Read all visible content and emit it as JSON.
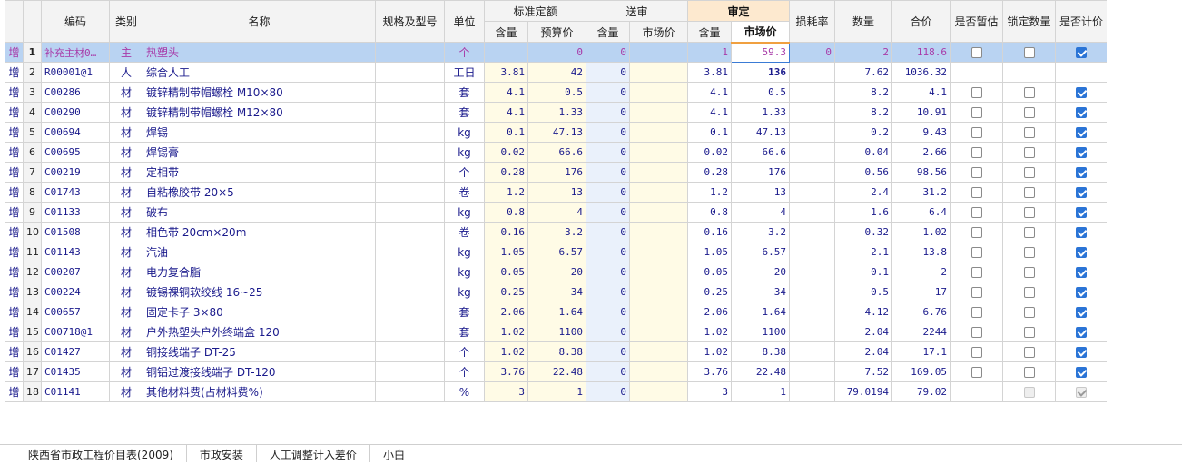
{
  "headers": {
    "code": "编码",
    "category": "类别",
    "name": "名称",
    "spec": "规格及型号",
    "unit": "单位",
    "standard_group": "标准定额",
    "submit_group": "送审",
    "audit_group": "审定",
    "loss_rate": "损耗率",
    "quantity": "数量",
    "total": "合价",
    "is_estimate": "是否暂估",
    "lock_qty": "锁定数量",
    "is_priced": "是否计价",
    "sub_qty": "含量",
    "sub_budget": "预算价",
    "sub_market": "市场价"
  },
  "rows": [
    {
      "ind": "增",
      "idx": "1",
      "code": "补充主材0…",
      "cat": "主",
      "name": "热塑头",
      "spec": "",
      "unit": "个",
      "std_qty": "",
      "std_price": "0",
      "sub_qty": "0",
      "sub_market": "",
      "aud_qty": "1",
      "aud_market": "59.3",
      "loss": "0",
      "qty": "2",
      "total": "118.6",
      "est": "off",
      "lock": "off",
      "priced": "on"
    },
    {
      "ind": "增",
      "idx": "2",
      "code": "R00001@1",
      "cat": "人",
      "name": "综合人工",
      "spec": "",
      "unit": "工日",
      "std_qty": "3.81",
      "std_price": "42",
      "sub_qty": "0",
      "sub_market": "",
      "aud_qty": "3.81",
      "aud_market": "136",
      "loss": "",
      "qty": "7.62",
      "total": "1036.32",
      "est": "",
      "lock": "",
      "priced": ""
    },
    {
      "ind": "增",
      "idx": "3",
      "code": "C00286",
      "cat": "材",
      "name": "镀锌精制带帽螺栓 M10×80",
      "spec": "",
      "unit": "套",
      "std_qty": "4.1",
      "std_price": "0.5",
      "sub_qty": "0",
      "sub_market": "",
      "aud_qty": "4.1",
      "aud_market": "0.5",
      "loss": "",
      "qty": "8.2",
      "total": "4.1",
      "est": "off",
      "lock": "off",
      "priced": "on"
    },
    {
      "ind": "增",
      "idx": "4",
      "code": "C00290",
      "cat": "材",
      "name": "镀锌精制带帽螺栓 M12×80",
      "spec": "",
      "unit": "套",
      "std_qty": "4.1",
      "std_price": "1.33",
      "sub_qty": "0",
      "sub_market": "",
      "aud_qty": "4.1",
      "aud_market": "1.33",
      "loss": "",
      "qty": "8.2",
      "total": "10.91",
      "est": "off",
      "lock": "off",
      "priced": "on"
    },
    {
      "ind": "增",
      "idx": "5",
      "code": "C00694",
      "cat": "材",
      "name": "焊锡",
      "spec": "",
      "unit": "kg",
      "std_qty": "0.1",
      "std_price": "47.13",
      "sub_qty": "0",
      "sub_market": "",
      "aud_qty": "0.1",
      "aud_market": "47.13",
      "loss": "",
      "qty": "0.2",
      "total": "9.43",
      "est": "off",
      "lock": "off",
      "priced": "on"
    },
    {
      "ind": "增",
      "idx": "6",
      "code": "C00695",
      "cat": "材",
      "name": "焊锡膏",
      "spec": "",
      "unit": "kg",
      "std_qty": "0.02",
      "std_price": "66.6",
      "sub_qty": "0",
      "sub_market": "",
      "aud_qty": "0.02",
      "aud_market": "66.6",
      "loss": "",
      "qty": "0.04",
      "total": "2.66",
      "est": "off",
      "lock": "off",
      "priced": "on"
    },
    {
      "ind": "增",
      "idx": "7",
      "code": "C00219",
      "cat": "材",
      "name": "定相带",
      "spec": "",
      "unit": "个",
      "std_qty": "0.28",
      "std_price": "176",
      "sub_qty": "0",
      "sub_market": "",
      "aud_qty": "0.28",
      "aud_market": "176",
      "loss": "",
      "qty": "0.56",
      "total": "98.56",
      "est": "off",
      "lock": "off",
      "priced": "on"
    },
    {
      "ind": "增",
      "idx": "8",
      "code": "C01743",
      "cat": "材",
      "name": "自粘橡胶带 20×5",
      "spec": "",
      "unit": "卷",
      "std_qty": "1.2",
      "std_price": "13",
      "sub_qty": "0",
      "sub_market": "",
      "aud_qty": "1.2",
      "aud_market": "13",
      "loss": "",
      "qty": "2.4",
      "total": "31.2",
      "est": "off",
      "lock": "off",
      "priced": "on"
    },
    {
      "ind": "增",
      "idx": "9",
      "code": "C01133",
      "cat": "材",
      "name": "破布",
      "spec": "",
      "unit": "kg",
      "std_qty": "0.8",
      "std_price": "4",
      "sub_qty": "0",
      "sub_market": "",
      "aud_qty": "0.8",
      "aud_market": "4",
      "loss": "",
      "qty": "1.6",
      "total": "6.4",
      "est": "off",
      "lock": "off",
      "priced": "on"
    },
    {
      "ind": "增",
      "idx": "10",
      "code": "C01508",
      "cat": "材",
      "name": "相色带 20cm×20m",
      "spec": "",
      "unit": "卷",
      "std_qty": "0.16",
      "std_price": "3.2",
      "sub_qty": "0",
      "sub_market": "",
      "aud_qty": "0.16",
      "aud_market": "3.2",
      "loss": "",
      "qty": "0.32",
      "total": "1.02",
      "est": "off",
      "lock": "off",
      "priced": "on"
    },
    {
      "ind": "增",
      "idx": "11",
      "code": "C01143",
      "cat": "材",
      "name": "汽油",
      "spec": "",
      "unit": "kg",
      "std_qty": "1.05",
      "std_price": "6.57",
      "sub_qty": "0",
      "sub_market": "",
      "aud_qty": "1.05",
      "aud_market": "6.57",
      "loss": "",
      "qty": "2.1",
      "total": "13.8",
      "est": "off",
      "lock": "off",
      "priced": "on"
    },
    {
      "ind": "增",
      "idx": "12",
      "code": "C00207",
      "cat": "材",
      "name": "电力复合脂",
      "spec": "",
      "unit": "kg",
      "std_qty": "0.05",
      "std_price": "20",
      "sub_qty": "0",
      "sub_market": "",
      "aud_qty": "0.05",
      "aud_market": "20",
      "loss": "",
      "qty": "0.1",
      "total": "2",
      "est": "off",
      "lock": "off",
      "priced": "on"
    },
    {
      "ind": "增",
      "idx": "13",
      "code": "C00224",
      "cat": "材",
      "name": "镀锡裸铜软绞线 16~25",
      "spec": "",
      "unit": "kg",
      "std_qty": "0.25",
      "std_price": "34",
      "sub_qty": "0",
      "sub_market": "",
      "aud_qty": "0.25",
      "aud_market": "34",
      "loss": "",
      "qty": "0.5",
      "total": "17",
      "est": "off",
      "lock": "off",
      "priced": "on"
    },
    {
      "ind": "增",
      "idx": "14",
      "code": "C00657",
      "cat": "材",
      "name": "固定卡子 3×80",
      "spec": "",
      "unit": "套",
      "std_qty": "2.06",
      "std_price": "1.64",
      "sub_qty": "0",
      "sub_market": "",
      "aud_qty": "2.06",
      "aud_market": "1.64",
      "loss": "",
      "qty": "4.12",
      "total": "6.76",
      "est": "off",
      "lock": "off",
      "priced": "on"
    },
    {
      "ind": "增",
      "idx": "15",
      "code": "C00718@1",
      "cat": "材",
      "name": "户外热塑头户外终端盒 120",
      "spec": "",
      "unit": "套",
      "std_qty": "1.02",
      "std_price": "1100",
      "sub_qty": "0",
      "sub_market": "",
      "aud_qty": "1.02",
      "aud_market": "1100",
      "loss": "",
      "qty": "2.04",
      "total": "2244",
      "est": "off",
      "lock": "off",
      "priced": "on"
    },
    {
      "ind": "增",
      "idx": "16",
      "code": "C01427",
      "cat": "材",
      "name": "铜接线端子 DT-25",
      "spec": "",
      "unit": "个",
      "std_qty": "1.02",
      "std_price": "8.38",
      "sub_qty": "0",
      "sub_market": "",
      "aud_qty": "1.02",
      "aud_market": "8.38",
      "loss": "",
      "qty": "2.04",
      "total": "17.1",
      "est": "off",
      "lock": "off",
      "priced": "on"
    },
    {
      "ind": "增",
      "idx": "17",
      "code": "C01435",
      "cat": "材",
      "name": "铜铝过渡接线端子 DT-120",
      "spec": "",
      "unit": "个",
      "std_qty": "3.76",
      "std_price": "22.48",
      "sub_qty": "0",
      "sub_market": "",
      "aud_qty": "3.76",
      "aud_market": "22.48",
      "loss": "",
      "qty": "7.52",
      "total": "169.05",
      "est": "off",
      "lock": "off",
      "priced": "on"
    },
    {
      "ind": "增",
      "idx": "18",
      "code": "C01141",
      "cat": "材",
      "name": "其他材料费(占材料费%)",
      "spec": "",
      "unit": "%",
      "std_qty": "3",
      "std_price": "1",
      "sub_qty": "0",
      "sub_market": "",
      "aud_qty": "3",
      "aud_market": "1",
      "loss": "",
      "qty": "79.0194",
      "total": "79.02",
      "est": "",
      "lock": "dis-off",
      "priced": "dis-on"
    }
  ],
  "bottom_tabs": [
    "陕西省市政工程价目表(2009)",
    "市政安装",
    "人工调整计入差价",
    "小白"
  ]
}
